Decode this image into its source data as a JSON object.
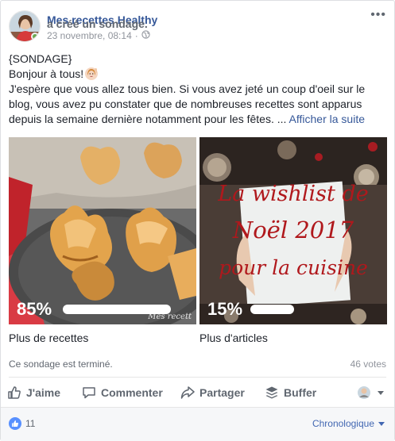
{
  "post": {
    "author": "Mes recettes Healthy",
    "action": "a créé un sondage.",
    "timestamp": "23 novembre, 08:14",
    "separator": "·",
    "more_icon": "more-dots-icon",
    "audience_icon": "globe-icon",
    "text_line1": "{SONDAGE}",
    "text_line2": "Bonjour à tous!",
    "text_line2_emoji": "woman-raising-hand-emoji",
    "text_body": "J'espère que vous allez tous bien. Si vous avez jeté un coup d'oeil sur le blog, vous avez pu constater que de nombreuses recettes sont apparus depuis la semaine dernière notamment pour les fêtes. ...",
    "see_more": "Afficher la suite"
  },
  "poll": {
    "options": [
      {
        "label": "Plus de recettes",
        "percent_text": "85%",
        "percent": 85,
        "image_watermark": "Mes recett"
      },
      {
        "label": "Plus d'articles",
        "percent_text": "15%",
        "percent": 15,
        "image_title_1": "La wishlist de",
        "image_title_2": "Noël 2017",
        "image_title_3": "pour la cuisine"
      }
    ],
    "status": "Ce sondage est terminé.",
    "votes": "46 votes"
  },
  "actions": {
    "like": "J'aime",
    "comment": "Commenter",
    "share": "Partager",
    "buffer": "Buffer"
  },
  "footer": {
    "like_count": "11",
    "sort": "Chronologique"
  },
  "colors": {
    "link": "#365899",
    "accent": "#4267b2",
    "like_bubble": "#5890ff",
    "wishlist_title": "#b0181c"
  }
}
